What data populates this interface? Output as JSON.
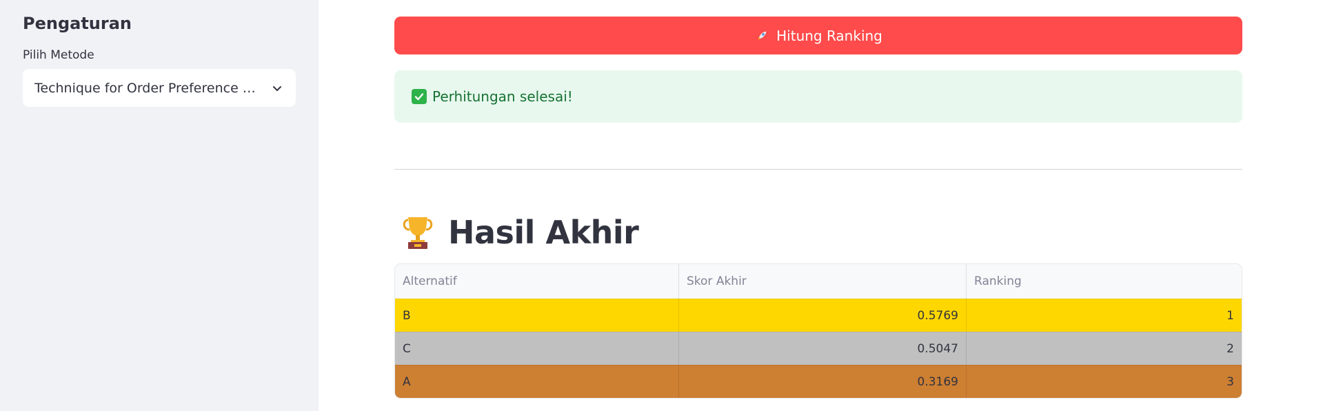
{
  "sidebar": {
    "title": "Pengaturan",
    "method_label": "Pilih Metode",
    "method_value": "Technique for Order Preference by Similarity to Ideal Solution (TOPSIS)",
    "chevron_icon": "chevron-down-icon"
  },
  "main": {
    "compute_button": {
      "label": "Hitung Ranking",
      "icon": "rocket-icon",
      "color": "#ff4b4b"
    },
    "success_alert": {
      "text": "Perhitungan selesai!",
      "icon": "check-mark-icon",
      "bg": "#e8f8ee"
    },
    "result_heading": {
      "text": "Hasil Akhir",
      "icon": "trophy-icon"
    },
    "table": {
      "columns": [
        "Alternatif",
        "Skor Akhir",
        "Ranking"
      ],
      "rows": [
        {
          "alternatif": "B",
          "skor": "0.5769",
          "ranking": "1",
          "bg": "#ffd700"
        },
        {
          "alternatif": "C",
          "skor": "0.5047",
          "ranking": "2",
          "bg": "#c0c0c0"
        },
        {
          "alternatif": "A",
          "skor": "0.3169",
          "ranking": "3",
          "bg": "#cd7f32"
        }
      ]
    }
  }
}
